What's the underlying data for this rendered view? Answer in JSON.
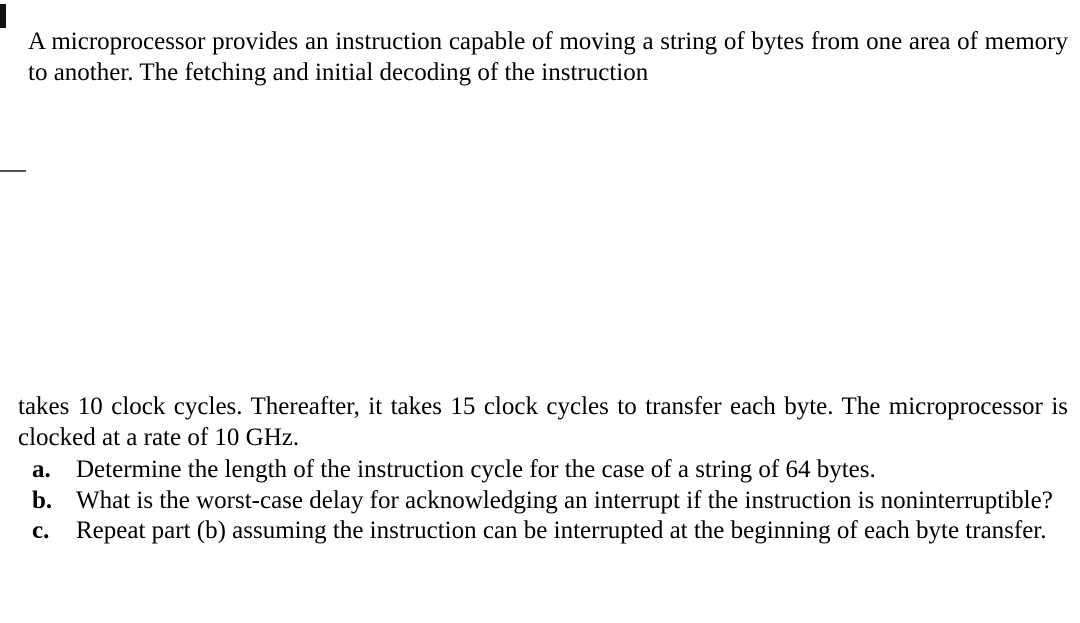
{
  "intro_top": "A microprocessor provides an instruction capable of moving a string of bytes from one area of memory to another. The fetching and initial decoding of the instruction",
  "intro_bottom": "takes 10 clock cycles. Thereafter, it takes 15 clock cycles to transfer each byte. The microprocessor is clocked at a rate of 10 GHz.",
  "items": [
    {
      "marker": "a.",
      "text": "Determine the length of the instruction cycle for the case of a string of 64 bytes."
    },
    {
      "marker": "b.",
      "text": "What is the worst-case delay for acknowledging an interrupt if the instruction is noninterruptible?"
    },
    {
      "marker": "c.",
      "text": "Repeat part (b) assuming the instruction can be interrupted at the beginning of each byte transfer."
    }
  ]
}
